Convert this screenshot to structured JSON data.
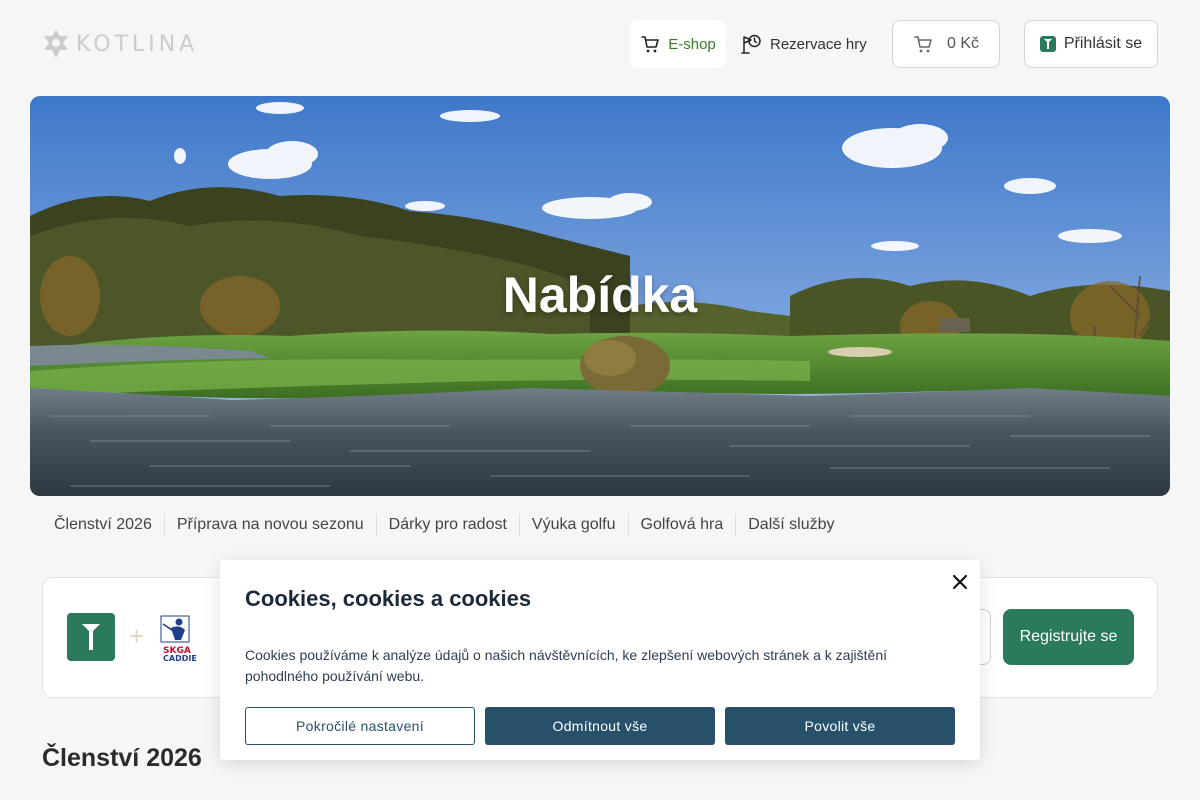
{
  "header": {
    "logo_text": "KOTLINA",
    "eshop_label": "E-shop",
    "reservation_label": "Rezervace hry",
    "cart_label": "0 Kč",
    "login_label": "Přihlásit se"
  },
  "hero": {
    "title": "Nabídka"
  },
  "subnav": {
    "items": [
      {
        "label": "Členství 2026"
      },
      {
        "label": "Příprava na novou sezonu"
      },
      {
        "label": "Dárky pro radost"
      },
      {
        "label": "Výuka golfu"
      },
      {
        "label": "Golfová hra"
      },
      {
        "label": "Další služby"
      }
    ]
  },
  "promo": {
    "partner_logo_text": "SKGA CADDIE",
    "register_label": "Registrujte se"
  },
  "section": {
    "title": "Členství 2026"
  },
  "cookie": {
    "title": "Cookies, cookies a cookies",
    "text": "Cookies používáme k analýze údajů o našich návštěvnících, ke zlepšení webových stránek a k zajištění pohodlného používání webu.",
    "advanced_label": "Pokročilé nastavení",
    "reject_label": "Odmítnout vše",
    "accept_label": "Povolit vše"
  },
  "colors": {
    "brand_green": "#2b7a5c",
    "cookie_blue": "#27516b",
    "eshop_green": "#3a7a2a"
  },
  "icons": [
    "logo-icon",
    "cart-icon",
    "golf-flag-clock-icon",
    "tee-icon",
    "close-icon",
    "caddie-golfer-icon"
  ]
}
